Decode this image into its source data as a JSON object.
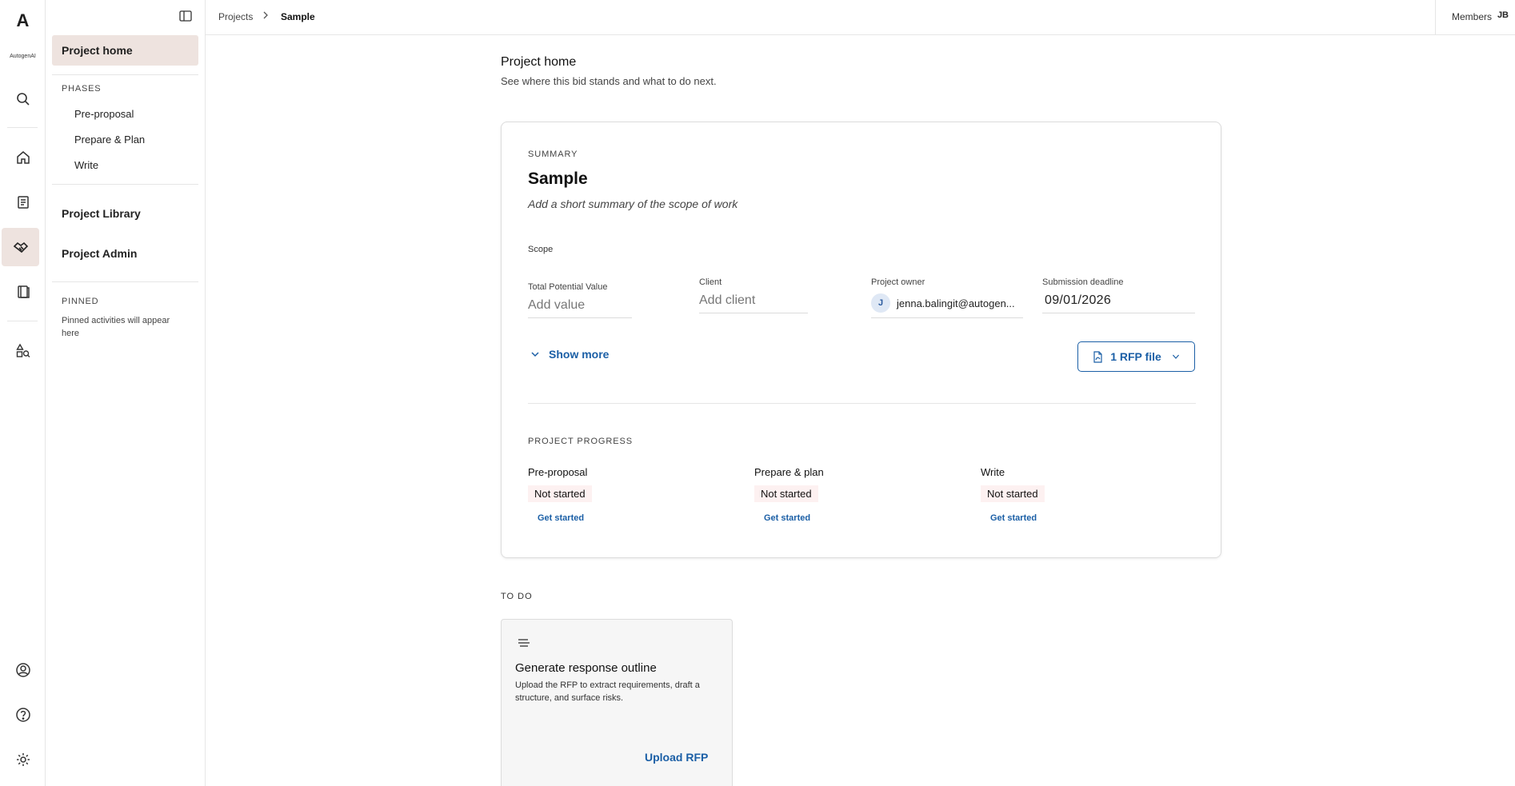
{
  "rail": {
    "logo_letter": "A",
    "logo_name": "AutogenAI",
    "icons": [
      "search-icon",
      "home-icon",
      "document-icon",
      "handshake-icon",
      "library-icon",
      "shapes-search-icon",
      "account-icon",
      "help-icon",
      "settings-icon"
    ],
    "active_icon": "handshake-icon"
  },
  "sidenav": {
    "home": "Project home",
    "phases_label": "PHASES",
    "phases": [
      "Pre-proposal",
      "Prepare & Plan",
      "Write"
    ],
    "library": "Project Library",
    "admin": "Project Admin",
    "pinned_label": "PINNED",
    "pinned_empty": "Pinned activities will appear here"
  },
  "topbar": {
    "breadcrumb": [
      "Projects",
      "Sample"
    ],
    "members_label": "Members",
    "avatar": "JB"
  },
  "main": {
    "title": "Project home",
    "subtitle": "See where this bid stands and what to do next.",
    "summary": {
      "label": "SUMMARY",
      "name": "Sample",
      "description_placeholder": "Add a short summary of the scope of work",
      "scope_label": "Scope",
      "fields": {
        "value_label": "Total Potential Value",
        "value_placeholder": "Add value",
        "client_label": "Client",
        "client_placeholder": "Add client",
        "owner_label": "Project owner",
        "owner_initial": "J",
        "owner_email": "jenna.balingit@autogen...",
        "deadline_label": "Submission deadline",
        "deadline": "09/01/2026"
      },
      "show_more": "Show more",
      "rfp_button": "1 RFP file"
    },
    "progress": {
      "label": "PROJECT PROGRESS",
      "phases": [
        {
          "name": "Pre-proposal",
          "status": "Not started",
          "action": "Get started"
        },
        {
          "name": "Prepare & plan",
          "status": "Not started",
          "action": "Get started"
        },
        {
          "name": "Write",
          "status": "Not started",
          "action": "Get started"
        }
      ]
    },
    "todo": {
      "label": "TO DO",
      "card": {
        "title": "Generate response outline",
        "description": "Upload the RFP to extract requirements, draft a structure, and surface risks.",
        "action": "Upload RFP"
      }
    }
  },
  "colors": {
    "accent": "#1b5fa6",
    "active_bg": "#eee3df",
    "status_bg": "#fdf1f1"
  }
}
